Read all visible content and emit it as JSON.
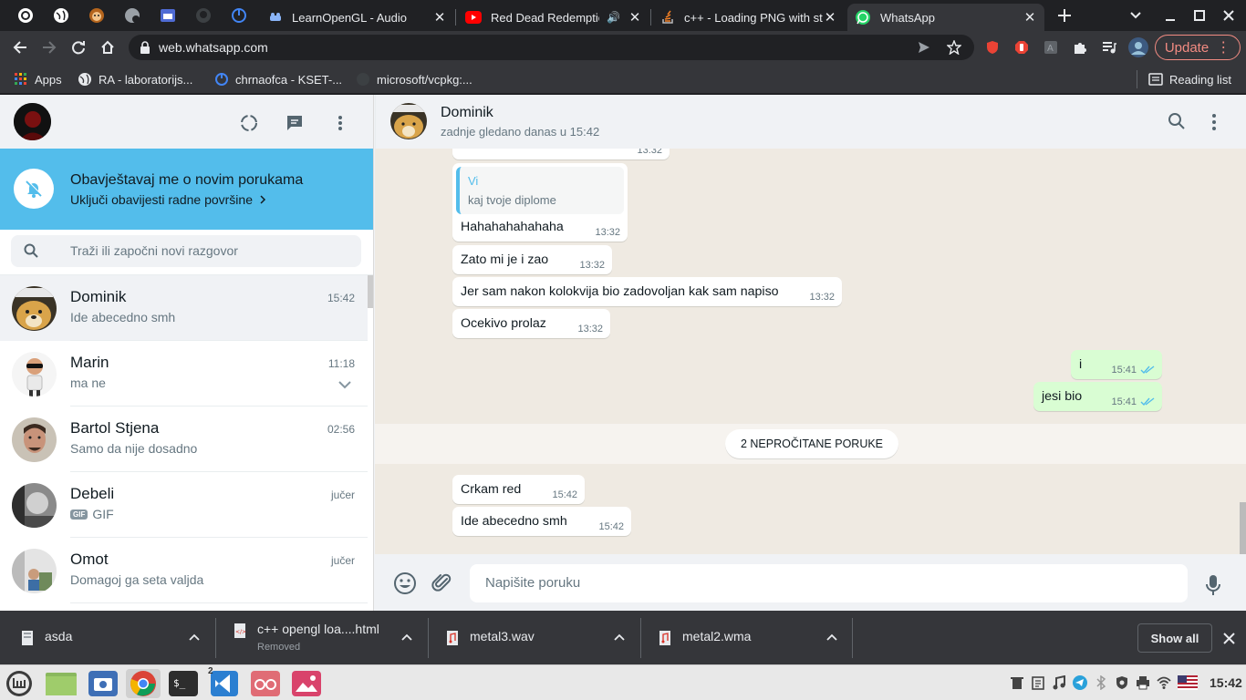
{
  "browser": {
    "tabs": [
      {
        "title": "LearnOpenGL - Audio",
        "icon": "learnopengl-icon"
      },
      {
        "title": "Red Dead Redemption",
        "icon": "youtube-icon",
        "audio": true
      },
      {
        "title": "c++ - Loading PNG with stb",
        "icon": "stackoverflow-icon"
      },
      {
        "title": "WhatsApp",
        "icon": "whatsapp-icon",
        "active": true
      }
    ],
    "url": "web.whatsapp.com",
    "update_label": "Update",
    "bookmarks": [
      {
        "label": "Apps",
        "icon": "apps-grid-icon"
      },
      {
        "label": "RA - laboratorijs...",
        "icon": "globe-icon"
      },
      {
        "label": "chrnaofca - KSET-...",
        "icon": "circle-icon"
      },
      {
        "label": "microsoft/vcpkg:...",
        "icon": "github-icon"
      }
    ],
    "reading_list": "Reading list"
  },
  "whatsapp": {
    "notification": {
      "title": "Obavještavaj me o novim porukama",
      "subtitle": "Uključi obavijesti radne površine"
    },
    "search_placeholder": "Traži ili započni novi razgovor",
    "chats": [
      {
        "name": "Dominik",
        "time": "15:42",
        "preview": "Ide abecedno smh",
        "selected": true
      },
      {
        "name": "Marin",
        "time": "11:18",
        "preview": "ma ne"
      },
      {
        "name": "Bartol Stjena",
        "time": "02:56",
        "preview": "Samo da nije dosadno"
      },
      {
        "name": "Debeli",
        "time": "jučer",
        "preview": "GIF",
        "badge": "GIF"
      },
      {
        "name": "Omot",
        "time": "jučer",
        "preview": "Domagoj ga seta valjda"
      }
    ],
    "conversation": {
      "name": "Dominik",
      "status": "zadnje gledano danas u 15:42",
      "top_partial_time": "13:32",
      "quote": {
        "author": "Vi",
        "text": "kaj tvoje diplome"
      },
      "messages": [
        {
          "text": "Hahahahahahaha",
          "time": "13:32",
          "dir": "in"
        },
        {
          "text": "Zato mi je i zao",
          "time": "13:32",
          "dir": "in"
        },
        {
          "text": "Jer sam nakon kolokvija bio zadovoljan kak sam napiso",
          "time": "13:32",
          "dir": "in"
        },
        {
          "text": "Ocekivo prolaz",
          "time": "13:32",
          "dir": "in"
        },
        {
          "text": "i",
          "time": "15:41",
          "dir": "out"
        },
        {
          "text": "jesi bio",
          "time": "15:41",
          "dir": "out"
        },
        {
          "text": "Crkam red",
          "time": "15:42",
          "dir": "in"
        },
        {
          "text": "Ide abecedno smh",
          "time": "15:42",
          "dir": "in"
        }
      ],
      "unread_label": "2 NEPROČITANE PORUKE"
    },
    "input_placeholder": "Napišite poruku"
  },
  "downloads": [
    {
      "name": "asda",
      "sub": ""
    },
    {
      "name": "c++ opengl loa....html",
      "sub": "Removed"
    },
    {
      "name": "metal3.wav",
      "sub": ""
    },
    {
      "name": "metal2.wma",
      "sub": ""
    }
  ],
  "show_all": "Show all",
  "taskbar": {
    "clock": "15:42",
    "vscode_badge": "2"
  },
  "colors": {
    "whatsapp_green": "#25d366",
    "notif_blue": "#53bdeb",
    "tick_blue": "#53bdeb",
    "out_bubble": "#d9fdd3"
  }
}
